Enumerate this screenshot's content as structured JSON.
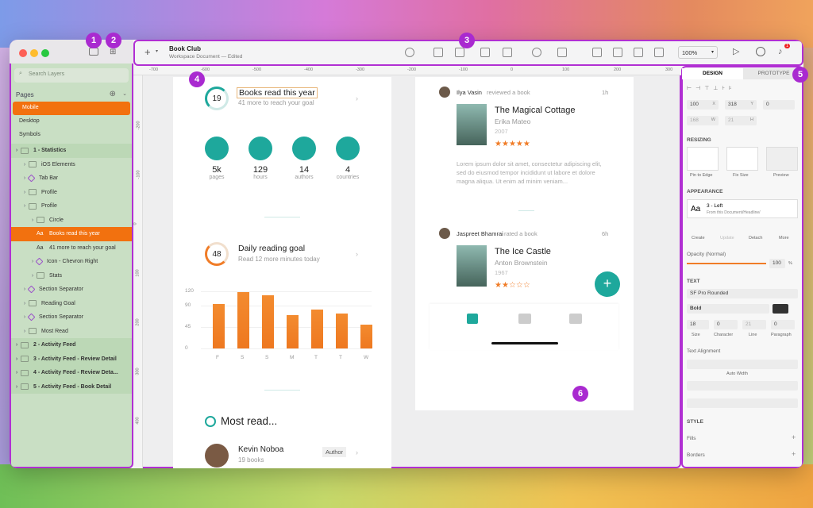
{
  "badges": [
    "1",
    "2",
    "3",
    "4",
    "5",
    "6"
  ],
  "sidebar": {
    "search_placeholder": "Search Layers",
    "pages_label": "Pages",
    "pages": [
      {
        "label": "Mobile"
      },
      {
        "label": "Desktop"
      },
      {
        "label": "Symbols"
      }
    ],
    "layers": [
      {
        "label": "1 - Statistics",
        "type": "artboard"
      },
      {
        "label": "iOS Elements",
        "type": "folder"
      },
      {
        "label": "Tab Bar",
        "type": "symbol"
      },
      {
        "label": "Profile",
        "type": "folder"
      },
      {
        "label": "Profile",
        "type": "folder"
      },
      {
        "label": "Circle",
        "type": "folder"
      },
      {
        "label": "Books read this year",
        "type": "text",
        "selected": true
      },
      {
        "label": "41 more to reach your goal",
        "type": "text"
      },
      {
        "label": "Icon - Chevron Right",
        "type": "symbol"
      },
      {
        "label": "Stats",
        "type": "folder"
      },
      {
        "label": "Section Separator",
        "type": "symbol"
      },
      {
        "label": "Reading Goal",
        "type": "folder"
      },
      {
        "label": "Section Separator",
        "type": "symbol"
      },
      {
        "label": "Most Read",
        "type": "folder"
      },
      {
        "label": "2 - Activity Feed",
        "type": "artboard"
      },
      {
        "label": "3 - Activity Feed - Review Detail",
        "type": "artboard"
      },
      {
        "label": "4 - Activity Feed - Review Deta...",
        "type": "artboard"
      },
      {
        "label": "5 - Activity Feed - Book Detail",
        "type": "artboard"
      }
    ]
  },
  "toolbar": {
    "title": "Book Club",
    "subtitle": "Workspace Document — Edited",
    "zoom": "100%",
    "notif_count": "1"
  },
  "rulers": {
    "top": [
      "-700",
      "-600",
      "-500",
      "-400",
      "-300",
      "-200",
      "-100",
      "0",
      "100",
      "200",
      "300"
    ],
    "left": [
      "-200",
      "-100",
      "0",
      "100",
      "200",
      "300",
      "400"
    ]
  },
  "artboard1": {
    "ring1": "19",
    "books_title": "Books read this year",
    "books_sub": "41 more to reach your goal",
    "stats": [
      {
        "value": "5k",
        "label": "pages"
      },
      {
        "value": "129",
        "label": "hours"
      },
      {
        "value": "14",
        "label": "authors"
      },
      {
        "value": "4",
        "label": "countries"
      }
    ],
    "ring2": "48",
    "goal_title": "Daily reading goal",
    "goal_sub": "Read 12 more minutes today",
    "most_read": "Most read...",
    "author_name": "Kevin Noboa",
    "author_books": "19 books",
    "author_tag": "Author"
  },
  "chart_data": {
    "type": "bar",
    "categories": [
      "F",
      "S",
      "S",
      "M",
      "T",
      "T",
      "W"
    ],
    "values": [
      94,
      118,
      112,
      70,
      82,
      74,
      50
    ],
    "ylim": [
      0,
      120
    ],
    "yticks": [
      "120",
      "90",
      "45",
      "0"
    ]
  },
  "artboard2": {
    "feed": [
      {
        "user": "Ilya Vasin",
        "action": "reviewed a book",
        "time": "1h",
        "title": "The Magical Cottage",
        "author": "Erika Mateo",
        "year": "2007",
        "stars": 5,
        "review": "Lorem ipsum dolor sit amet, consectetur adipiscing elit, sed do eiusmod tempor incididunt ut labore et dolore magna aliqua. Ut enim ad minim veniam..."
      },
      {
        "user": "Jaspreet Bhamrai",
        "action": "rated a book",
        "time": "6h",
        "title": "The Ice Castle",
        "author": "Anton Brownstein",
        "year": "1967",
        "stars": 2
      }
    ]
  },
  "inspector": {
    "tab_design": "DESIGN",
    "tab_prototype": "PROTOTYPE",
    "x": "100",
    "x_l": "X",
    "y": "318",
    "y_l": "Y",
    "rot": "0",
    "w": "168",
    "w_l": "W",
    "h": "21",
    "h_l": "H",
    "resizing": "RESIZING",
    "pin": "Pin to Edge",
    "fix": "Fix Size",
    "preview": "Preview",
    "appearance": "APPEARANCE",
    "style_name": "3 - Left",
    "style_from": "From this Document/Headline/",
    "create": "Create",
    "update": "Update",
    "detach": "Detach",
    "more": "More",
    "opacity_label": "Opacity (Normal)",
    "opacity": "100",
    "pct": "%",
    "text": "TEXT",
    "font": "SF Pro Rounded",
    "weight": "Bold",
    "size": "18",
    "size_l": "Size",
    "char": "0",
    "char_l": "Character",
    "line": "21",
    "line_l": "Line",
    "para": "0",
    "para_l": "Paragraph",
    "text_align": "Text Alignment",
    "auto_width": "Auto Width",
    "style": "STYLE",
    "fills": "Fills",
    "borders": "Borders"
  }
}
